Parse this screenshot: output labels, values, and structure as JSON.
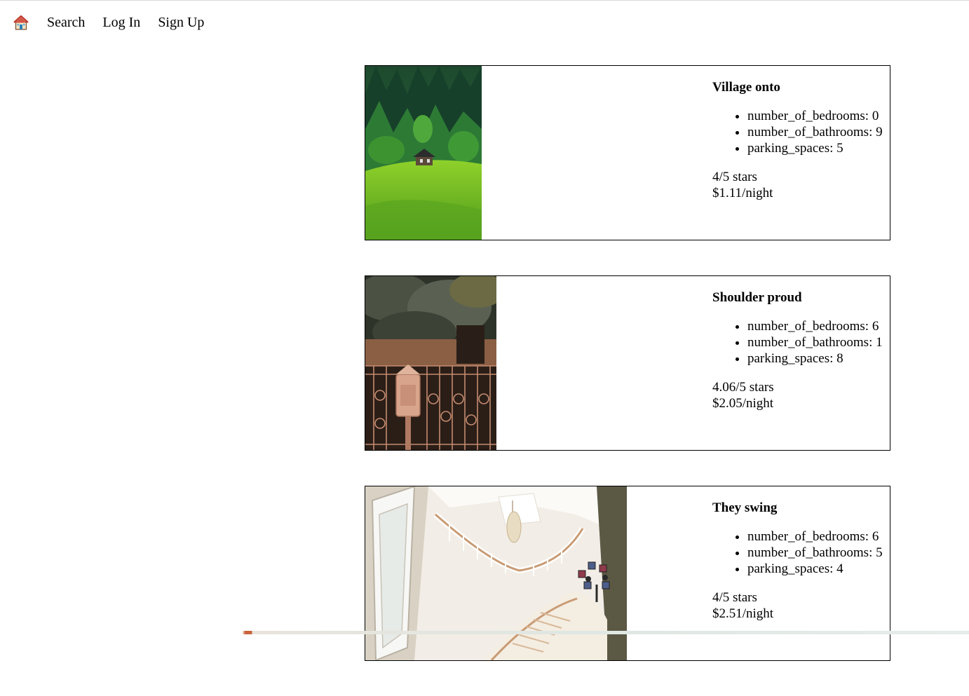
{
  "nav": {
    "home_icon": "home-icon",
    "items": [
      {
        "label": "Search"
      },
      {
        "label": "Log In"
      },
      {
        "label": "Sign Up"
      }
    ]
  },
  "listings": [
    {
      "title": "Village onto",
      "photo": "forest-hillside-cabin-photo",
      "details": [
        "number_of_bedrooms: 0",
        "number_of_bathrooms: 9",
        "parking_spaces: 5"
      ],
      "rating": "4/5 stars",
      "price": "$1.11/night"
    },
    {
      "title": "Shoulder proud",
      "photo": "iron-gate-mailbox-photo",
      "details": [
        "number_of_bedrooms: 6",
        "number_of_bathrooms: 1",
        "parking_spaces: 8"
      ],
      "rating": "4.06/5 stars",
      "price": "$2.05/night"
    },
    {
      "title": "They swing",
      "photo": "spiral-staircase-interior-photo",
      "details": [
        "number_of_bedrooms: 6",
        "number_of_bathrooms: 5",
        "parking_spaces: 4"
      ],
      "rating": "4/5 stars",
      "price": "$2.51/night"
    }
  ],
  "colors": {
    "border": "#000000",
    "background": "#ffffff"
  }
}
